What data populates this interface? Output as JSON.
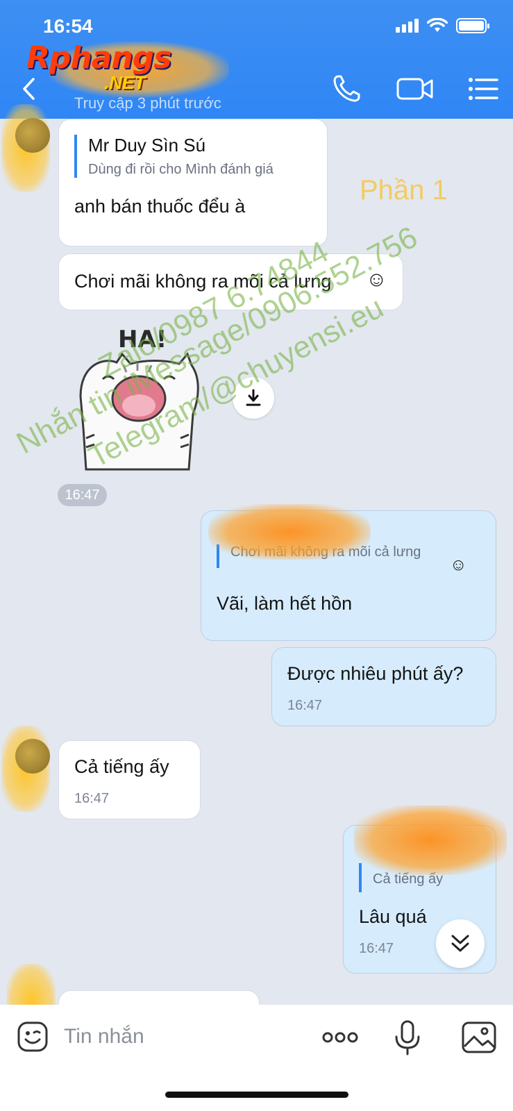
{
  "status_bar": {
    "time": "16:54"
  },
  "header": {
    "logo_main": "Rphangs",
    "logo_suffix": ".NET",
    "last_seen": "Truy cập 3 phút trước"
  },
  "messages": {
    "m1": {
      "quote_author": "Mr Duy Sìn Sú",
      "quote_text": "Dùng đi rồi cho Mình đánh giá",
      "text": "anh bán thuốc đểu à"
    },
    "m2": {
      "text": "Chơi mãi không ra mõi cả lưng"
    },
    "sticker_time": "16:47",
    "m3": {
      "quote_text": "Chơi mãi không ra mõi cả lưng",
      "text": "Vãi, làm hết hồn"
    },
    "m4": {
      "text": "Được nhiêu phút ấy?",
      "time": "16:47"
    },
    "m5": {
      "text": "Cả tiếng ấy",
      "time": "16:47"
    },
    "m6": {
      "quote_text": "Cả tiếng ấy",
      "text": "Lâu quá",
      "time": "16:47"
    }
  },
  "sticker": {
    "text": "HA!"
  },
  "overlay": {
    "part_label": "Phần 1",
    "watermark_1": "Zalo/0987 6.74844",
    "watermark_2": "Nhắn tin iMessage/0906.552.756",
    "watermark_3": "Telegram/@chuyensi.eu"
  },
  "input": {
    "placeholder": "Tin nhắn"
  },
  "icons": {
    "back": "chevron-left-icon",
    "call": "phone-icon",
    "video": "video-camera-icon",
    "menu": "list-menu-icon",
    "download": "download-icon",
    "scroll": "chevron-double-down-icon",
    "emoji": "sticker-face-icon",
    "more": "more-dots-icon",
    "mic": "microphone-icon",
    "image": "image-icon"
  },
  "colors": {
    "header": "#2f86f5",
    "my_bubble": "#d6ecfd",
    "their_bubble": "#ffffff",
    "background": "#e3e7ef"
  }
}
